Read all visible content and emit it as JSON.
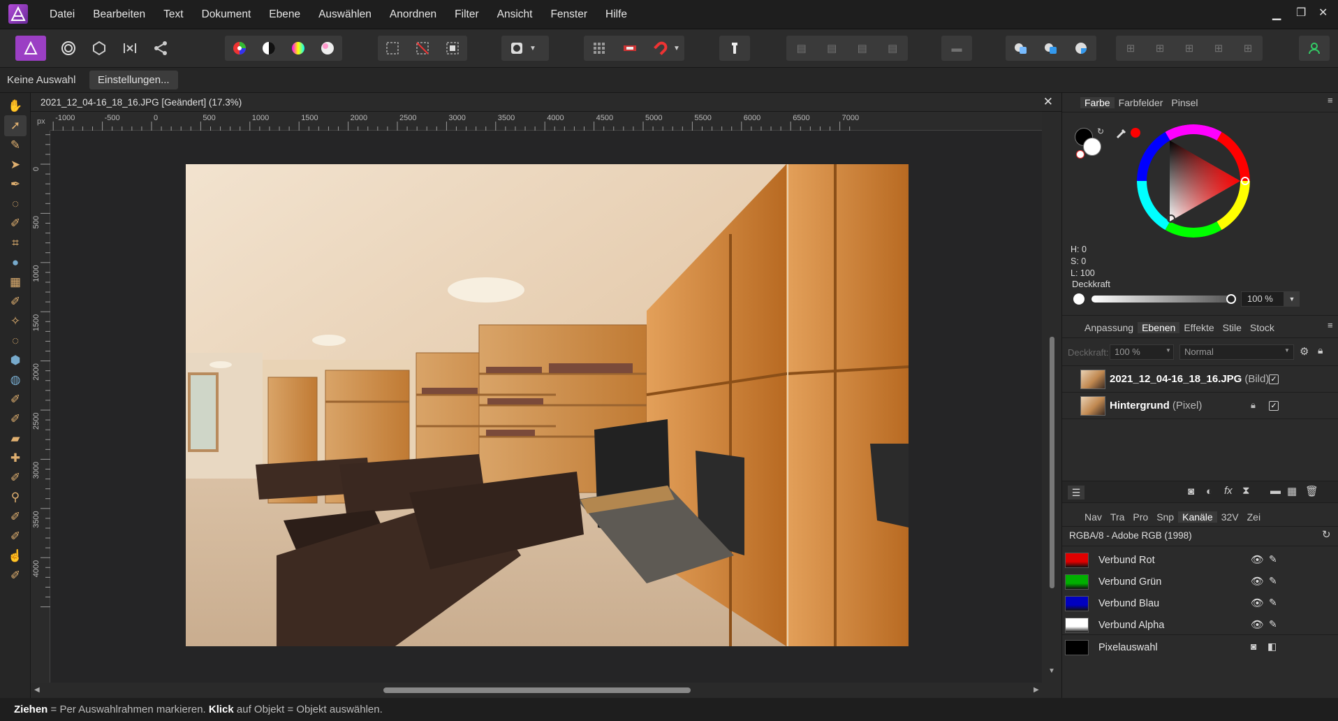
{
  "app": {
    "name": "Affinity Photo"
  },
  "menu": [
    "Datei",
    "Bearbeiten",
    "Text",
    "Dokument",
    "Ebene",
    "Auswählen",
    "Anordnen",
    "Filter",
    "Ansicht",
    "Fenster",
    "Hilfe"
  ],
  "context_bar": {
    "selection_label": "Keine Auswahl",
    "settings_button": "Einstellungen..."
  },
  "document": {
    "tab_title": "2021_12_04-16_18_16.JPG [Geändert] (17.3%)",
    "ruler_unit": "px",
    "h_ruler_labels": [
      "-1000",
      "-500",
      "0",
      "500",
      "1000",
      "1500",
      "2000",
      "2500",
      "3000",
      "3500",
      "4000",
      "4500",
      "5000",
      "5500",
      "6000",
      "6500",
      "7000"
    ],
    "v_ruler_labels": [
      "0",
      "500",
      "1000",
      "1500",
      "2000",
      "2500",
      "3000",
      "3500",
      "4000"
    ]
  },
  "color_panel": {
    "tabs": [
      "Farbe",
      "Farbfelder",
      "Pinsel"
    ],
    "active_tab": "Farbe",
    "h": "H: 0",
    "s": "S: 0",
    "l": "L: 100",
    "opacity_label": "Deckkraft",
    "opacity_value": "100 %",
    "picker_color": "#ff0000"
  },
  "layers_panel": {
    "tabs": [
      "Anpassung",
      "Ebenen",
      "Effekte",
      "Stile",
      "Stock"
    ],
    "active_tab": "Ebenen",
    "opacity_label": "Deckkraft:",
    "opacity_value": "100 %",
    "blend_mode": "Normal",
    "layers": [
      {
        "name": "2021_12_04-16_18_16.JPG",
        "type": "(Bild)",
        "visible": true,
        "locked": false
      },
      {
        "name": "Hintergrund",
        "type": "(Pixel)",
        "visible": true,
        "locked": true
      }
    ]
  },
  "channels_panel": {
    "tabs": [
      "Nav",
      "Tra",
      "Pro",
      "Snp",
      "Kanäle",
      "32V",
      "Zei"
    ],
    "active_tab": "Kanäle",
    "profile": "RGBA/8 - Adobe RGB (1998)",
    "channels": [
      {
        "name": "Verbund Rot",
        "color": "#e00000"
      },
      {
        "name": "Verbund Grün",
        "color": "#00b000"
      },
      {
        "name": "Verbund Blau",
        "color": "#0000c0"
      },
      {
        "name": "Verbund Alpha",
        "color": "#ffffff"
      }
    ],
    "pixel_selection": "Pixelauswahl"
  },
  "status": {
    "bold1": "Ziehen",
    "text1": " = Per Auswahlrahmen markieren. ",
    "bold2": "Klick",
    "text2": " auf Objekt = Objekt auswählen."
  },
  "icons": {
    "tools": [
      "hand-icon",
      "move-icon",
      "color-picker-icon",
      "node-icon",
      "pen-icon",
      "lasso-icon",
      "brush-icon",
      "crop-icon",
      "sphere-icon",
      "mesh-icon",
      "retouch-icon",
      "magic-wand-icon",
      "selection-brush-icon",
      "fill-icon",
      "gradient-icon",
      "paint-brush-icon",
      "color-replace-icon",
      "eraser-icon",
      "healing-icon",
      "clone-icon",
      "zoom-icon",
      "dodge-icon",
      "burn-icon",
      "smudge-icon",
      "sponge-icon"
    ]
  }
}
